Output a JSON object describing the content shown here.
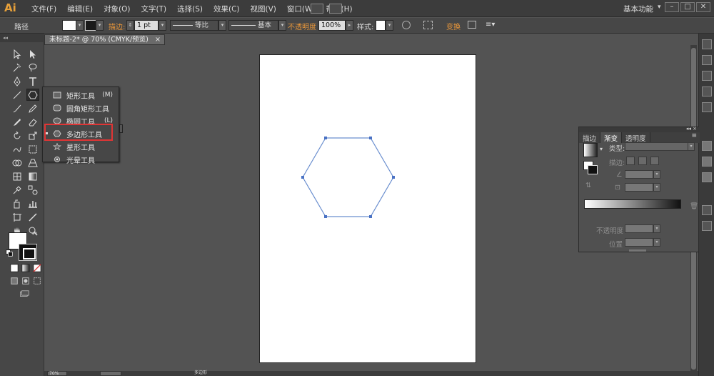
{
  "app": {
    "logo": "Ai",
    "accent": "#e8a13a"
  },
  "menu": [
    "文件(F)",
    "编辑(E)",
    "对象(O)",
    "文字(T)",
    "选择(S)",
    "效果(C)",
    "视图(V)",
    "窗口(W)",
    "帮助(H)"
  ],
  "workspace": {
    "label": "基本功能",
    "arrow": "▾"
  },
  "window_controls": {
    "minimize": "–",
    "maximize": "□",
    "close": "✕"
  },
  "control_bar": {
    "selection_label": "路径",
    "stroke_label": "描边:",
    "stroke_weight": "1 pt",
    "profile": "等比",
    "brush": "基本",
    "opacity_label": "不透明度",
    "opacity_value": "100%",
    "style_label": "样式:",
    "transform_label": "变换"
  },
  "document": {
    "tab": "未标题-2* @ 70% (CMYK/预览)",
    "close_glyph": "×"
  },
  "tools_panel": {
    "grip": "◂◂"
  },
  "flyout": {
    "items": [
      {
        "label": "矩形工具",
        "shortcut": "(M)",
        "icon": "rectangle-icon"
      },
      {
        "label": "圆角矩形工具",
        "shortcut": "",
        "icon": "rounded-rectangle-icon"
      },
      {
        "label": "椭圆工具",
        "shortcut": "(L)",
        "icon": "ellipse-icon"
      },
      {
        "label": "多边形工具",
        "shortcut": "",
        "icon": "polygon-icon"
      },
      {
        "label": "星形工具",
        "shortcut": "",
        "icon": "star-icon"
      },
      {
        "label": "光晕工具",
        "shortcut": "",
        "icon": "flare-icon"
      }
    ],
    "selected": "多边形工具",
    "highlight_color": "#e03535"
  },
  "gradient_panel": {
    "tabs": [
      "描边",
      "渐变",
      "透明度"
    ],
    "active_tab": "渐变",
    "type_label": "类型:",
    "stroke_label": "描边:",
    "opacity_label": "不透明度",
    "position_label": "位置",
    "gradient_colors": [
      "#ffffff",
      "#111111"
    ]
  },
  "shape": {
    "type": "hexagon",
    "stroke_color": "#6b8fcf"
  },
  "status": {
    "zoom": "70%",
    "tool": "多边形"
  }
}
